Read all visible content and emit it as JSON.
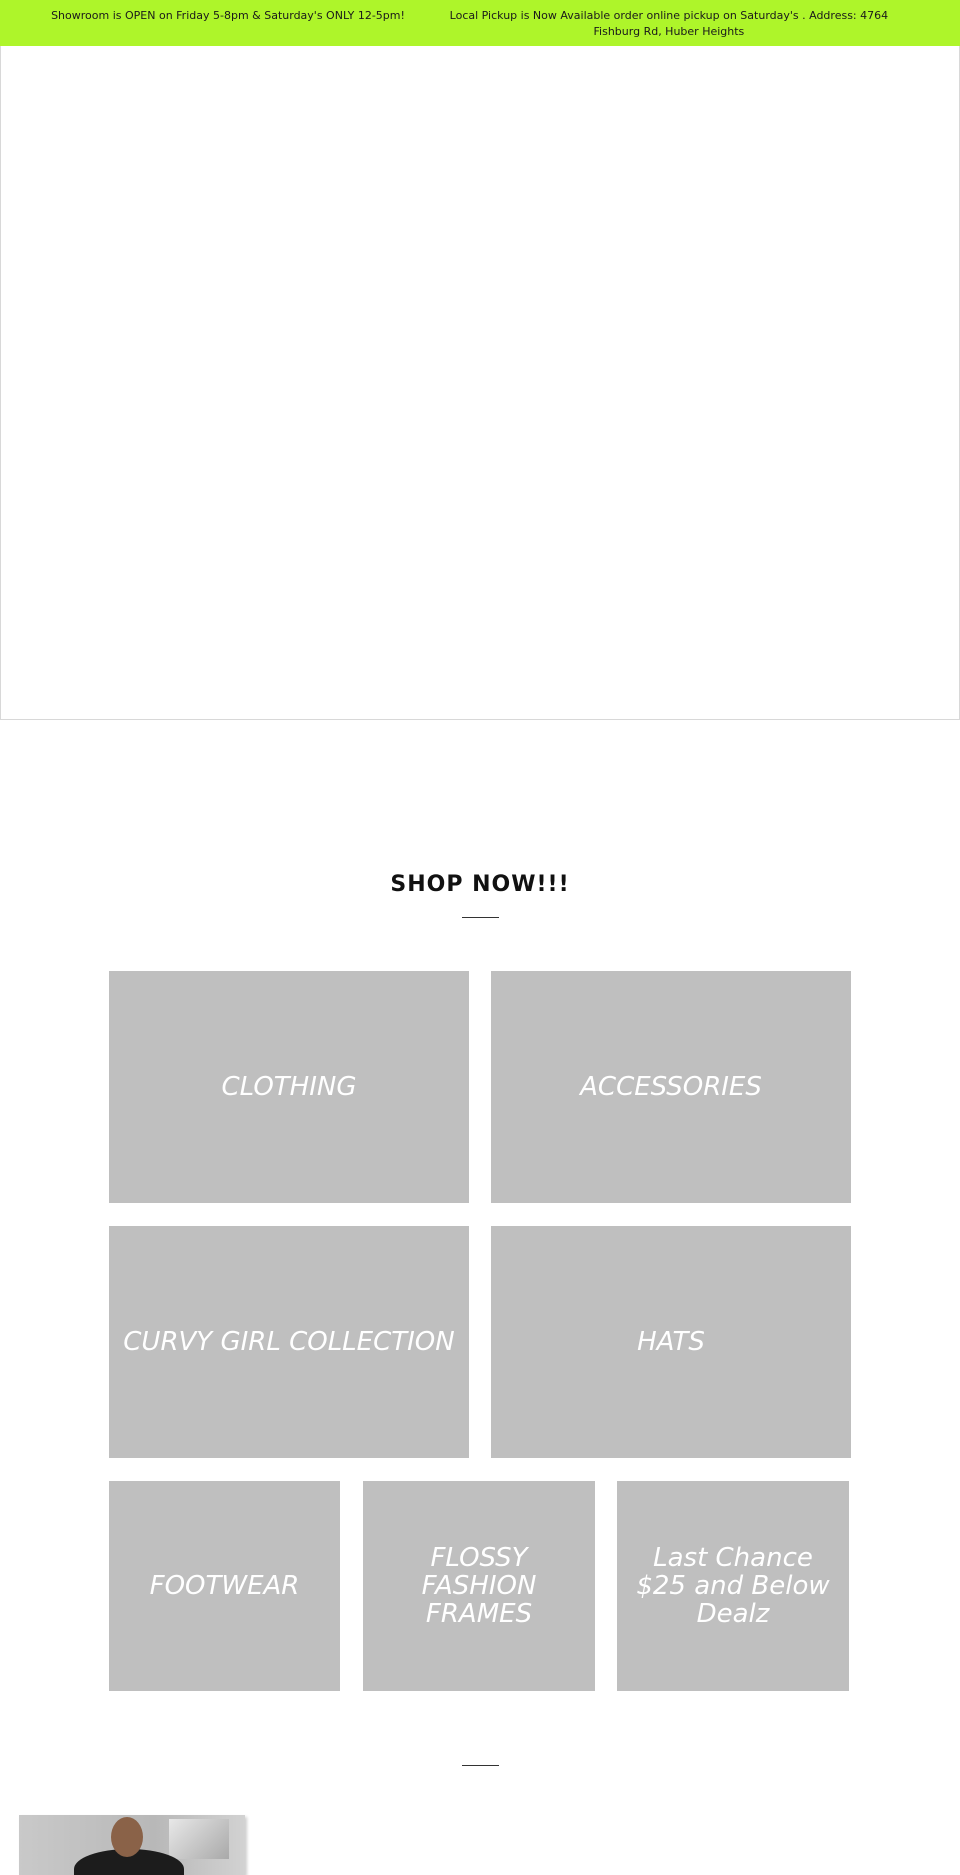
{
  "announcement": {
    "message_1": "Showroom is OPEN on Friday 5-8pm & Saturday's ONLY 12-5pm!",
    "message_2": "Local Pickup is Now Available order online pickup on Saturday's . Address: 4764 Fishburg Rd, Huber Heights"
  },
  "colors": {
    "announcement_bg": "#aef52a",
    "tile_bg": "#bfbfbf",
    "tile_text": "#ffffff"
  },
  "collections": {
    "title": "SHOP NOW!!!",
    "tiles": [
      {
        "label": "CLOTHING"
      },
      {
        "label": "ACCESSORIES"
      },
      {
        "label": "CURVY GIRL COLLECTION"
      },
      {
        "label": "HATS"
      },
      {
        "label": "FOOTWEAR"
      },
      {
        "label": "FLOSSY FASHION FRAMES"
      },
      {
        "label": "Last Chance $25 and Below Dealz"
      }
    ]
  }
}
